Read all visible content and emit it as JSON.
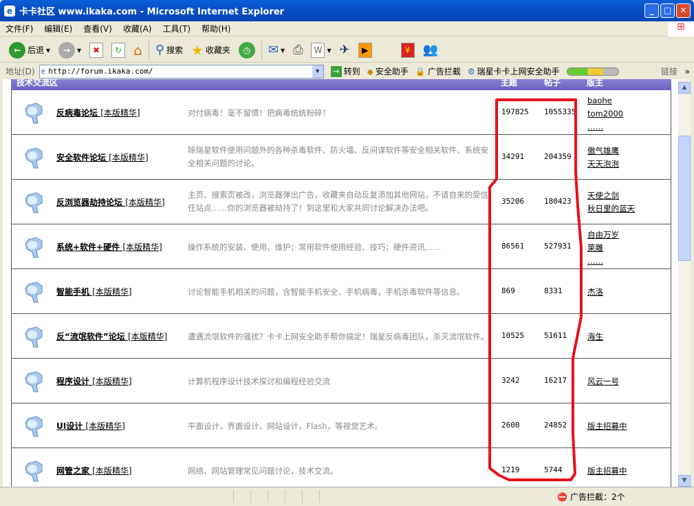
{
  "window": {
    "title": "卡卡社区 www.ikaka.com - Microsoft Internet Explorer"
  },
  "menu": [
    "文件(F)",
    "编辑(E)",
    "查看(V)",
    "收藏(A)",
    "工具(T)",
    "帮助(H)"
  ],
  "toolbar": {
    "back": "后退",
    "search": "搜索",
    "favorites": "收藏夹"
  },
  "address": {
    "label": "地址(D)",
    "url": "http://forum.ikaka.com/",
    "go": "转到",
    "links": [
      "安全助手",
      "广告拦截",
      "瑞星卡卡上网安全助手"
    ],
    "links_label": "链接"
  },
  "section": {
    "title": "技术交流区",
    "col_topics": "主题",
    "col_posts": "帖子",
    "col_mods": "版主"
  },
  "essence_label": "本版精华",
  "forums": [
    {
      "name": "反病毒论坛",
      "desc": "对付病毒！毫不留情！把病毒统统粉碎！",
      "topics": "197825",
      "posts": "1055335",
      "mods": [
        "baohe",
        "tom2000",
        "……"
      ]
    },
    {
      "name": "安全软件论坛",
      "desc": "除瑞星软件使用问题外的各种杀毒软件、防火墙、反间谍软件等安全相关软件、系统安全相关问题的讨论。",
      "topics": "34291",
      "posts": "204359",
      "mods": [
        "傲气雄鹰",
        "天天泡泡"
      ]
    },
    {
      "name": "反浏览器劫持论坛",
      "desc": "主页、搜索页被改，浏览器弹出广告，收藏夹自动反复添加其他网站，不请自来的受信任站点……你的浏览器被劫持了！到这里和大家共同讨论解决办法吧。",
      "topics": "35206",
      "posts": "180423",
      "mods": [
        "天使之剑",
        "秋日里的蓝天"
      ]
    },
    {
      "name": "系统+软件+硬件",
      "desc": "操作系统的安装、使用、维护；常用软件使用经验、技巧；硬件资讯……",
      "topics": "86561",
      "posts": "527931",
      "mods": [
        "自由万岁",
        "萊雕",
        "……"
      ]
    },
    {
      "name": "智能手机",
      "desc": "讨论智能手机相关的问题，含智能手机安全、手机病毒，手机杀毒软件等信息。",
      "topics": "869",
      "posts": "8331",
      "mods": [
        "杰洛"
      ]
    },
    {
      "name": "反“流氓软件”论坛",
      "desc": "遭遇流氓软件的骚扰？卡卡上网安全助手帮你搞定！瑞星反病毒团队，杀灭流氓软件。",
      "topics": "10525",
      "posts": "51611",
      "mods": [
        "海生"
      ]
    },
    {
      "name": "程序设计",
      "desc": "计算机程序设计技术探讨和编程经验交流",
      "topics": "3242",
      "posts": "16217",
      "mods": [
        "风云一号"
      ]
    },
    {
      "name": "UI设计",
      "desc": "平面设计，界面设计，网站设计，Flash，等视觉艺术。",
      "topics": "2600",
      "posts": "24852",
      "mods": [
        "版主招募中"
      ]
    },
    {
      "name": "网管之家",
      "desc": "网络、网站管理常见问题讨论，技术交流。",
      "topics": "1219",
      "posts": "5744",
      "mods": [
        "版主招募中"
      ]
    }
  ],
  "status": {
    "ad_block": "广告拦截：2个"
  },
  "colors": {
    "annotation": "#e8101a",
    "header": "#7a70c8"
  }
}
